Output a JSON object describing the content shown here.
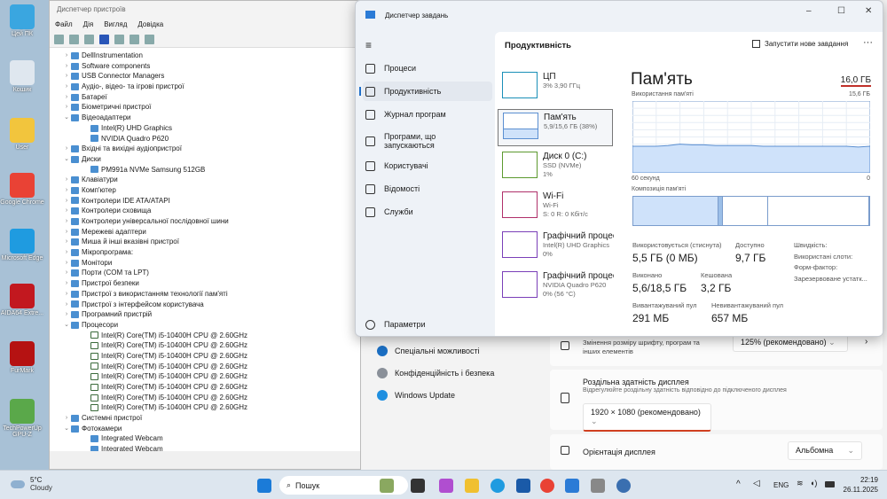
{
  "desktop": {
    "icons": [
      {
        "label": "Цей ПК",
        "color": "#3aa6e0"
      },
      {
        "label": "Кошик",
        "color": "#dfe7ef"
      },
      {
        "label": "User",
        "color": "#f2c53d"
      },
      {
        "label": "Google Chrome",
        "color": "#e94235"
      },
      {
        "label": "Microsoft Edge",
        "color": "#1f9be0"
      },
      {
        "label": "AIDA64 Extre...",
        "color": "#c2181f"
      },
      {
        "label": "FurMark",
        "color": "#b51212"
      },
      {
        "label": "TechPowerUp GPU-Z",
        "color": "#5aa84a"
      }
    ]
  },
  "device_manager": {
    "title": "Диспетчер пристроїв",
    "menu": [
      "Файл",
      "Дія",
      "Вигляд",
      "Довідка"
    ],
    "tree": [
      {
        "label": "DellInstrumentation",
        "level": 0,
        "expanded": false
      },
      {
        "label": "Software components",
        "level": 0,
        "expanded": false
      },
      {
        "label": "USB Connector Managers",
        "level": 0,
        "expanded": false
      },
      {
        "label": "Аудіо-, відео- та ігрові пристрої",
        "level": 0,
        "expanded": false
      },
      {
        "label": "Батареї",
        "level": 0,
        "expanded": false
      },
      {
        "label": "Біометричні пристрої",
        "level": 0,
        "expanded": false
      },
      {
        "label": "Відеоадаптери",
        "level": 0,
        "expanded": true
      },
      {
        "label": "Intel(R) UHD Graphics",
        "level": 1
      },
      {
        "label": "NVIDIA Quadro P620",
        "level": 1
      },
      {
        "label": "Вхідні та вихідні аудіопристрої",
        "level": 0,
        "expanded": false
      },
      {
        "label": "Диски",
        "level": 0,
        "expanded": true
      },
      {
        "label": "PM991a NVMe Samsung 512GB",
        "level": 1
      },
      {
        "label": "Клавіатури",
        "level": 0,
        "expanded": false
      },
      {
        "label": "Комп'ютер",
        "level": 0,
        "expanded": false
      },
      {
        "label": "Контролери IDE ATA/ATAPI",
        "level": 0,
        "expanded": false
      },
      {
        "label": "Контролери сховища",
        "level": 0,
        "expanded": false
      },
      {
        "label": "Контролери універсальної послідовної шини",
        "level": 0,
        "expanded": false
      },
      {
        "label": "Мережеві адаптери",
        "level": 0,
        "expanded": false
      },
      {
        "label": "Миша й інші вказівні пристрої",
        "level": 0,
        "expanded": false
      },
      {
        "label": "Мікропрограма:",
        "level": 0,
        "expanded": false
      },
      {
        "label": "Монітори",
        "level": 0,
        "expanded": false
      },
      {
        "label": "Порти (COM та LPT)",
        "level": 0,
        "expanded": false
      },
      {
        "label": "Пристрої безпеки",
        "level": 0,
        "expanded": false
      },
      {
        "label": "Пристрої з використанням технології пам'яті",
        "level": 0,
        "expanded": false
      },
      {
        "label": "Пристрої з інтерфейсом користувача",
        "level": 0,
        "expanded": false
      },
      {
        "label": "Програмний пристрій",
        "level": 0,
        "expanded": false
      },
      {
        "label": "Процесори",
        "level": 0,
        "expanded": true
      },
      {
        "label": "Intel(R) Core(TM) i5-10400H CPU @ 2.60GHz",
        "level": 1
      },
      {
        "label": "Intel(R) Core(TM) i5-10400H CPU @ 2.60GHz",
        "level": 1
      },
      {
        "label": "Intel(R) Core(TM) i5-10400H CPU @ 2.60GHz",
        "level": 1
      },
      {
        "label": "Intel(R) Core(TM) i5-10400H CPU @ 2.60GHz",
        "level": 1
      },
      {
        "label": "Intel(R) Core(TM) i5-10400H CPU @ 2.60GHz",
        "level": 1
      },
      {
        "label": "Intel(R) Core(TM) i5-10400H CPU @ 2.60GHz",
        "level": 1
      },
      {
        "label": "Intel(R) Core(TM) i5-10400H CPU @ 2.60GHz",
        "level": 1
      },
      {
        "label": "Intel(R) Core(TM) i5-10400H CPU @ 2.60GHz",
        "level": 1
      },
      {
        "label": "Системні пристрої",
        "level": 0,
        "expanded": false
      },
      {
        "label": "Фотокамери",
        "level": 0,
        "expanded": true
      },
      {
        "label": "Integrated Webcam",
        "level": 1
      },
      {
        "label": "Integrated Webcam",
        "level": 1
      }
    ]
  },
  "settings": {
    "nav": [
      {
        "label": "Спеціальні можливості",
        "color": "#1b6ec2"
      },
      {
        "label": "Конфіденційність і безпека",
        "color": "#8a9099"
      },
      {
        "label": "Windows Update",
        "color": "#1f8fe0"
      }
    ],
    "scale": {
      "label": "Змінення розміру шрифту, програм та інших елементів",
      "value": "125% (рекомендовано)"
    },
    "resolution": {
      "title": "Роздільна здатність дисплея",
      "desc": "Відрегулюйте роздільну здатність відповідно до  підключеного дисплея",
      "value": "1920 × 1080 (рекомендовано)"
    },
    "orientation": {
      "title": "Орієнтація дисплея",
      "value": "Альбомна"
    }
  },
  "task_manager": {
    "title": "Диспетчер завдань",
    "nav": [
      "Процеси",
      "Продуктивність",
      "Журнал програм",
      "Програми, що запускаються",
      "Користувачі",
      "Відомості",
      "Служби"
    ],
    "selected_nav": "Продуктивність",
    "settings_label": "Параметри",
    "header": "Продуктивність",
    "run_task": "Запустити нове завдання",
    "tiles": [
      {
        "name": "ЦП",
        "l1": "3% 3,90 ГГц",
        "l2": "",
        "color": "#1a8fb8"
      },
      {
        "name": "Пам'ять",
        "l1": "5,9/15,6 ГБ (38%)",
        "l2": "",
        "color": "#5b8fd1"
      },
      {
        "name": "Диск 0 (C:)",
        "l1": "SSD (NVMe)",
        "l2": "1%",
        "color": "#5c9a2f"
      },
      {
        "name": "Wi-Fi",
        "l1": "Wi-Fi",
        "l2": "S: 0 R: 0 Кбіт/с",
        "color": "#b0306a"
      },
      {
        "name": "Графічний процесор 0",
        "l1": "Intel(R) UHD Graphics",
        "l2": "0%",
        "color": "#7a3fb8"
      },
      {
        "name": "Графічний процесор 1",
        "l1": "NVIDIA Quadro P620",
        "l2": "0%  (56 °C)",
        "color": "#7a3fb8"
      }
    ],
    "memory": {
      "title": "Пам'ять",
      "total": "16,0 ГБ",
      "usage_label": "Використання пам'яті",
      "usage_max": "15,6 ГБ",
      "time_left": "60 секунд",
      "time_right": "0",
      "composition_label": "Композиція пам'яті",
      "usage_history_percent": [
        37,
        37,
        37,
        38,
        40,
        39,
        39,
        38,
        38,
        38,
        38,
        37,
        37,
        37,
        37,
        37,
        37,
        37,
        37,
        36,
        37
      ],
      "composition_percent": {
        "in_use": 36,
        "modified": 2,
        "standby": 19,
        "free": 43
      },
      "stats": [
        {
          "label": "Використовується (стиснута)",
          "value": "5,5 ГБ (0 МБ)"
        },
        {
          "label": "Доступно",
          "value": "9,7 ГБ"
        },
        {
          "label": "Виконано",
          "value": "5,6/18,5 ГБ"
        },
        {
          "label": "Кешована",
          "value": "3,2 ГБ"
        },
        {
          "label": "Вивантажуваний пул",
          "value": "291 МБ"
        },
        {
          "label": "Невивантажуваний пул",
          "value": "657 МБ"
        }
      ],
      "side": [
        "Швидкість:",
        "Використані слоти:",
        "Форм-фактор:",
        "Зарезервоване устатк..."
      ],
      "accent": "#cfe2fa",
      "line": "#5b8fd1"
    }
  },
  "taskbar": {
    "weather_temp": "5°C",
    "weather_text": "Cloudy",
    "search": "Пошук",
    "lang": "ENG",
    "time": "22:19",
    "date": "26.11.2025"
  }
}
